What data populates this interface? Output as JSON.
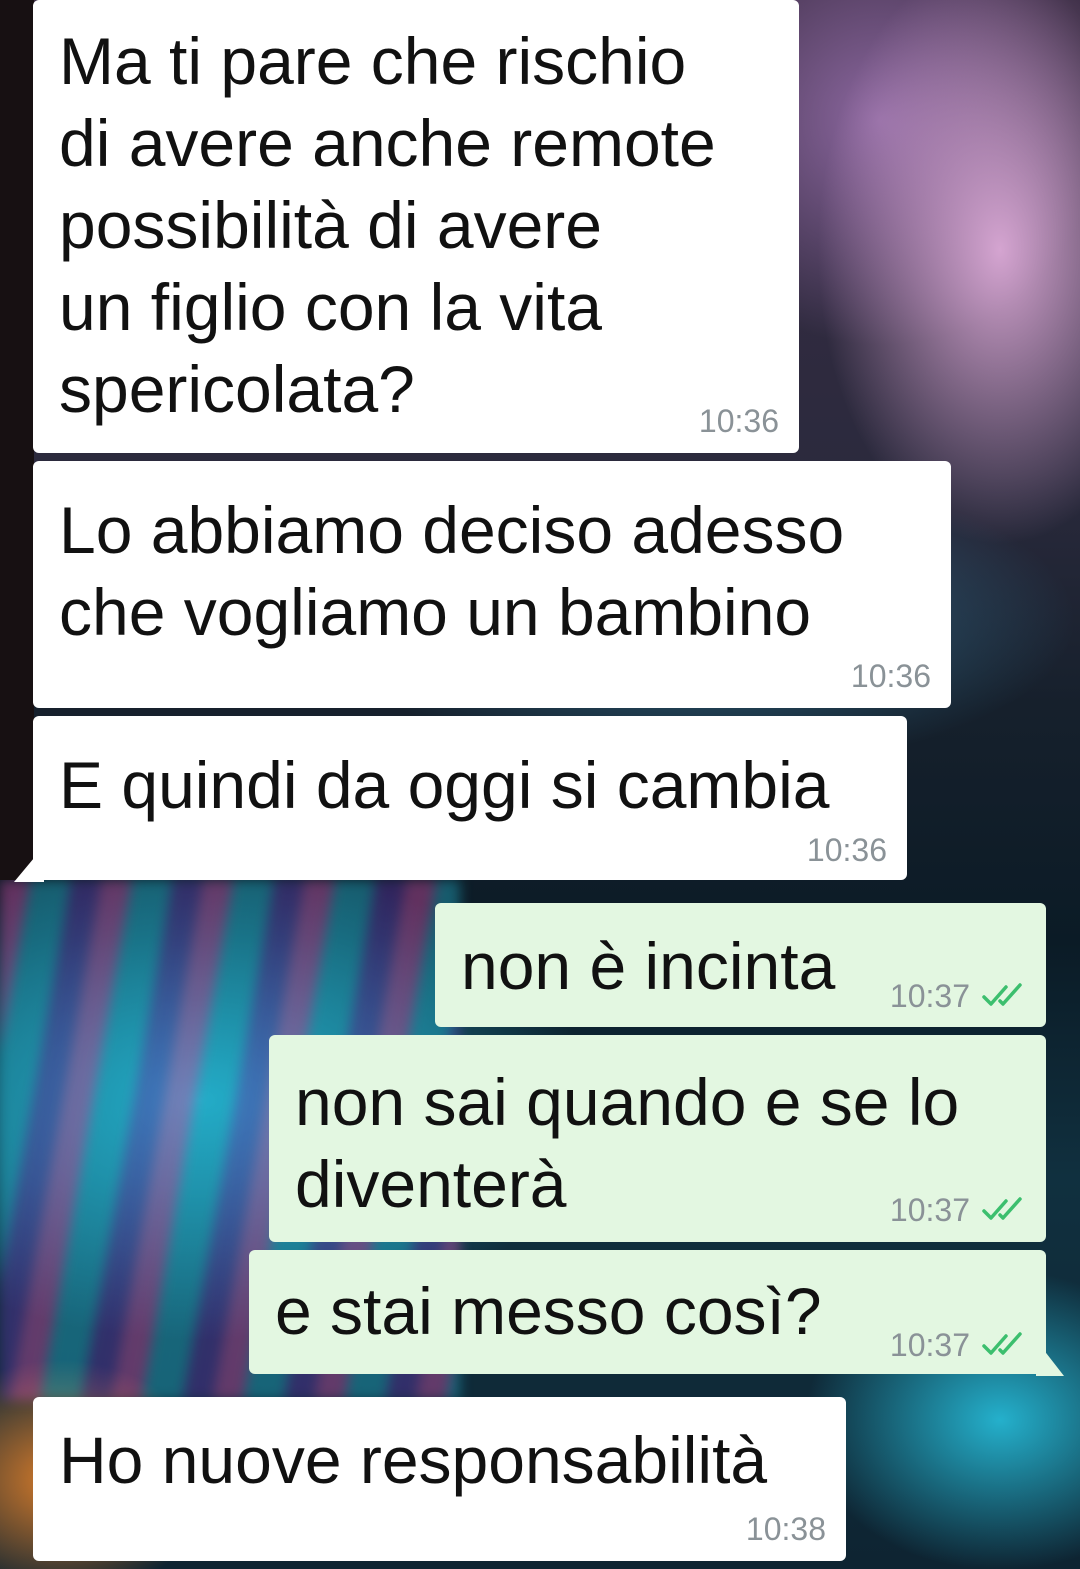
{
  "messages": [
    {
      "direction": "incoming",
      "text": "Ma ti pare che rischio\ndi avere anche remote\npossibilità di avere\nun figlio con la vita\nspericolata?",
      "time": "10:36"
    },
    {
      "direction": "incoming",
      "text": "Lo abbiamo deciso adesso\nche vogliamo un bambino",
      "time": "10:36"
    },
    {
      "direction": "incoming",
      "text": "E quindi da oggi si cambia",
      "time": "10:36"
    },
    {
      "direction": "outgoing",
      "text": "non è incinta",
      "time": "10:37",
      "status": "read"
    },
    {
      "direction": "outgoing",
      "text": "non sai quando e se lo\ndiventerà",
      "time": "10:37",
      "status": "read"
    },
    {
      "direction": "outgoing",
      "text": "e stai messo così?",
      "time": "10:37",
      "status": "read"
    },
    {
      "direction": "incoming",
      "text": "Ho nuove responsabilità",
      "time": "10:38"
    }
  ],
  "colors": {
    "incoming_bubble": "#ffffff",
    "outgoing_bubble": "#e3f7e1",
    "read_ticks": "#3cbf6e",
    "timestamp": "#8a9297"
  },
  "icons": {
    "read_status": "double-check-icon"
  }
}
